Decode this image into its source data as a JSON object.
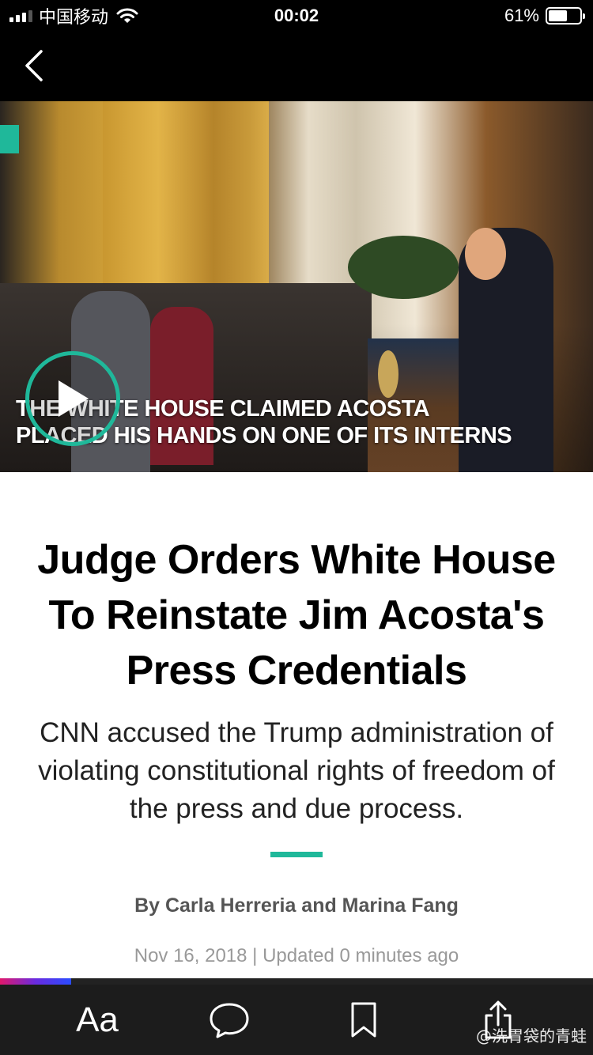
{
  "status_bar": {
    "carrier": "中国移动",
    "time": "00:02",
    "battery_percent": "61%",
    "battery_level": 0.61
  },
  "nav": {
    "back_icon": "chevron-left-icon"
  },
  "video": {
    "caption_line1": "THE WHITE HOUSE CLAIMED ACOSTA",
    "caption_line2": "PLACED HIS HANDS ON ONE OF ITS INTERNS",
    "play_icon": "play-icon",
    "accent_color": "#1fb89a"
  },
  "article": {
    "headline": "Judge Orders White House To Reinstate Jim Acosta's Press Credentials",
    "dek": "CNN accused the Trump administration of violating constitutional rights of freedom of the press and due process.",
    "byline": "By Carla Herreria and Marina Fang",
    "timestamp": "Nov 16, 2018 | Updated 0 minutes ago"
  },
  "reading_progress": 0.12,
  "toolbar": {
    "text_size_label": "Aa",
    "comment_icon": "comment-bubble-icon",
    "bookmark_icon": "bookmark-icon",
    "share_icon": "share-icon"
  },
  "watermark": "@洗胃袋的青蛙"
}
